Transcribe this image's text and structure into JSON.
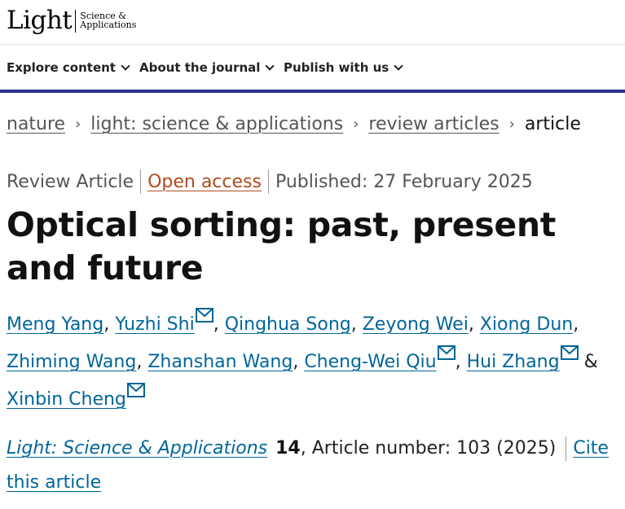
{
  "brand": {
    "logo_main": "Light",
    "logo_sub_line1": "Science &",
    "logo_sub_line2": "Applications"
  },
  "nav": {
    "items": [
      {
        "label": "Explore content"
      },
      {
        "label": "About the journal"
      },
      {
        "label": "Publish with us"
      }
    ],
    "accent_color": "#29308a"
  },
  "breadcrumb": {
    "items": [
      "nature",
      "light: science & applications",
      "review articles"
    ],
    "current": "article",
    "separator": "›"
  },
  "meta": {
    "article_type": "Review Article",
    "access": "Open access",
    "published": "Published: 27 February 2025"
  },
  "title": "Optical sorting: past, present and future",
  "authors": [
    {
      "name": "Meng Yang",
      "email": false
    },
    {
      "name": "Yuzhi Shi",
      "email": true
    },
    {
      "name": "Qinghua Song",
      "email": false
    },
    {
      "name": "Zeyong Wei",
      "email": false
    },
    {
      "name": "Xiong Dun",
      "email": false
    },
    {
      "name": "Zhiming Wang",
      "email": false
    },
    {
      "name": "Zhanshan Wang",
      "email": false
    },
    {
      "name": "Cheng-Wei Qiu",
      "email": true
    },
    {
      "name": "Hui Zhang",
      "email": true
    },
    {
      "name": "Xinbin Cheng",
      "email": true
    }
  ],
  "author_separators": {
    "comma": ",",
    "and": "&"
  },
  "citation": {
    "journal": "Light: Science & Applications",
    "volume": "14",
    "article_number": ", Article number: 103 (2025)",
    "cite_label": "Cite this article"
  },
  "colors": {
    "link": "#006699",
    "open_access": "#b04b1c",
    "text": "#222222"
  }
}
